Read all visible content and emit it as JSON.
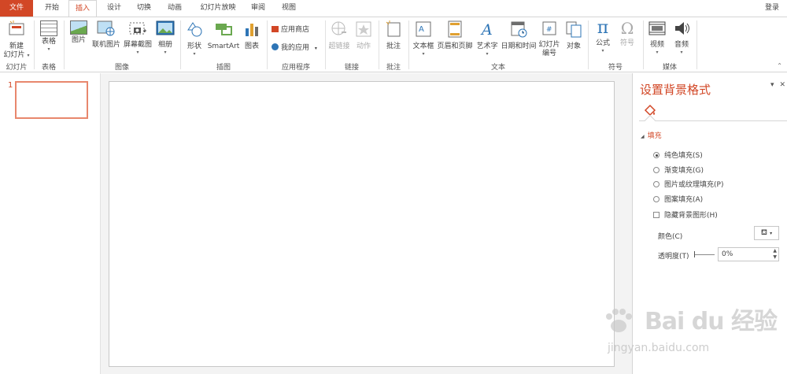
{
  "tabs": {
    "file": "文件",
    "home": "开始",
    "insert": "插入",
    "design": "设计",
    "transitions": "切换",
    "animations": "动画",
    "slideshow": "幻灯片放映",
    "review": "审阅",
    "view": "视图"
  },
  "account": {
    "login": "登录"
  },
  "ribbon": {
    "slides": {
      "new_slide": "新建",
      "new_slide_2": "幻灯片",
      "group": "幻灯片"
    },
    "tables": {
      "table": "表格",
      "group": "表格"
    },
    "images": {
      "pictures": "图片",
      "online_pictures": "联机图片",
      "screenshot": "屏幕截图",
      "album": "相册",
      "group": "图像"
    },
    "illustrations": {
      "shapes": "形状",
      "smartart": "SmartArt",
      "chart": "图表",
      "group": "插图"
    },
    "apps": {
      "store": "应用商店",
      "my_apps": "我的应用",
      "group": "应用程序"
    },
    "links": {
      "hyperlink": "超链接",
      "action": "动作",
      "group": "链接"
    },
    "comments": {
      "comment": "批注",
      "group": "批注"
    },
    "text": {
      "textbox": "文本框",
      "header_footer": "页眉和页脚",
      "wordart": "艺术字",
      "datetime": "日期和时间",
      "slide_number": "幻灯片",
      "slide_number_2": "编号",
      "object": "对象",
      "group": "文本"
    },
    "symbols": {
      "equation": "公式",
      "symbol": "符号",
      "group": "符号",
      "pi": "π",
      "omega": "Ω"
    },
    "media": {
      "video": "视频",
      "audio": "音频",
      "group": "媒体"
    }
  },
  "thumbnails": {
    "slide_number": "1"
  },
  "format_pane": {
    "title": "设置背景格式",
    "section": "填充",
    "options": [
      {
        "label": "纯色填充(S)",
        "selected": true
      },
      {
        "label": "渐变填充(G)",
        "selected": false
      },
      {
        "label": "图片或纹理填充(P)",
        "selected": false
      },
      {
        "label": "图案填充(A)",
        "selected": false
      }
    ],
    "hide_graphics": "隐藏背景图形(H)",
    "color_label": "颜色(C)",
    "transparency_label": "透明度(T)",
    "transparency_value": "0%"
  },
  "watermark": {
    "logo": "Bai du 经验",
    "url": "jingyan.baidu.com"
  },
  "colors": {
    "accent": "#d24726",
    "slide_border": "#e8876d"
  }
}
